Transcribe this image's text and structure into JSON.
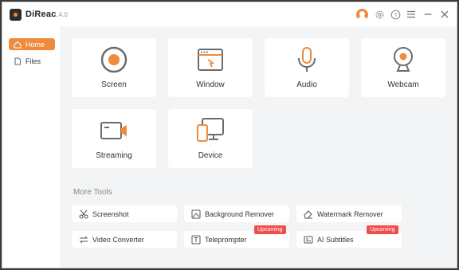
{
  "app": {
    "name": "DiReac",
    "version": "1.4.0"
  },
  "titlebar": {
    "icons": [
      "avatar-icon",
      "gear-icon",
      "help-icon",
      "menu-icon",
      "minimize-icon",
      "close-icon"
    ]
  },
  "sidebar": {
    "items": [
      {
        "label": "Home",
        "icon": "home-icon",
        "active": true
      },
      {
        "label": "Files",
        "icon": "file-icon",
        "active": false
      }
    ]
  },
  "cards": [
    {
      "label": "Screen",
      "icon": "record-icon"
    },
    {
      "label": "Window",
      "icon": "window-icon"
    },
    {
      "label": "Audio",
      "icon": "microphone-icon"
    },
    {
      "label": "Webcam",
      "icon": "webcam-icon"
    },
    {
      "label": "Streaming",
      "icon": "streaming-icon"
    },
    {
      "label": "Device",
      "icon": "device-icon"
    }
  ],
  "more_tools": {
    "title": "More Tools",
    "items": [
      {
        "label": "Screenshot",
        "icon": "scissors-icon",
        "badge": ""
      },
      {
        "label": "Background Remover",
        "icon": "image-icon",
        "badge": ""
      },
      {
        "label": "Watermark Remover",
        "icon": "eraser-icon",
        "badge": ""
      },
      {
        "label": "Video Converter",
        "icon": "convert-icon",
        "badge": ""
      },
      {
        "label": "Teleprompter",
        "icon": "text-icon",
        "badge": "Upcoming"
      },
      {
        "label": "AI Subtitles",
        "icon": "subtitle-icon",
        "badge": "Upcoming"
      }
    ]
  },
  "colors": {
    "accent": "#f08a3c",
    "badge": "#f04c4c",
    "background": "#f3f4f6"
  }
}
